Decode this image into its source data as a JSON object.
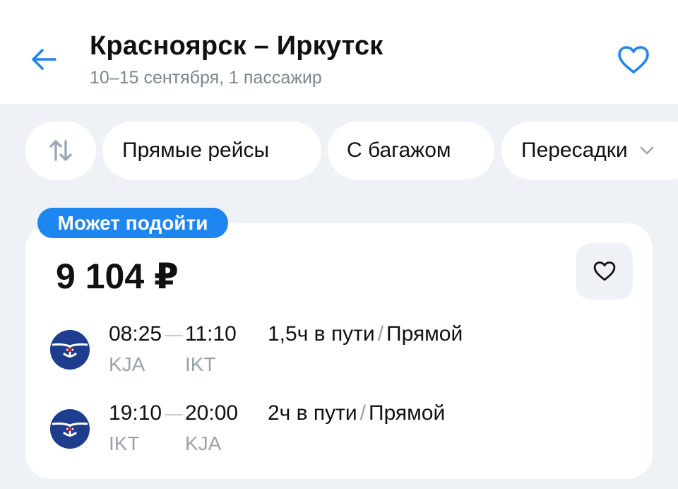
{
  "header": {
    "title": "Красноярск – Иркутск",
    "subtitle": "10–15 сентября, 1 пассажир",
    "back_icon": "arrow-left-icon",
    "favorite_icon": "heart-icon"
  },
  "filters": {
    "sort_icon": "sort-arrows-icon",
    "chips": [
      {
        "label": "Прямые рейсы"
      },
      {
        "label": "С багажом"
      },
      {
        "label": "Пересадки"
      }
    ]
  },
  "result": {
    "badge": "Может подойти",
    "price": "9 104 ₽",
    "segments": [
      {
        "departure_time": "08:25",
        "arrival_time": "11:10",
        "departure_code": "KJA",
        "arrival_code": "IKT",
        "duration": "1,5ч в пути",
        "separator": "/",
        "type": "Прямой"
      },
      {
        "departure_time": "19:10",
        "arrival_time": "20:00",
        "departure_code": "IKT",
        "arrival_code": "KJA",
        "duration": "2ч в пути",
        "separator": "/",
        "type": "Прямой"
      }
    ]
  },
  "colors": {
    "accent": "#1e86f0",
    "airline_logo": "#1f3d8f",
    "background": "#eef1f6",
    "muted_text": "#9aa1aa"
  }
}
